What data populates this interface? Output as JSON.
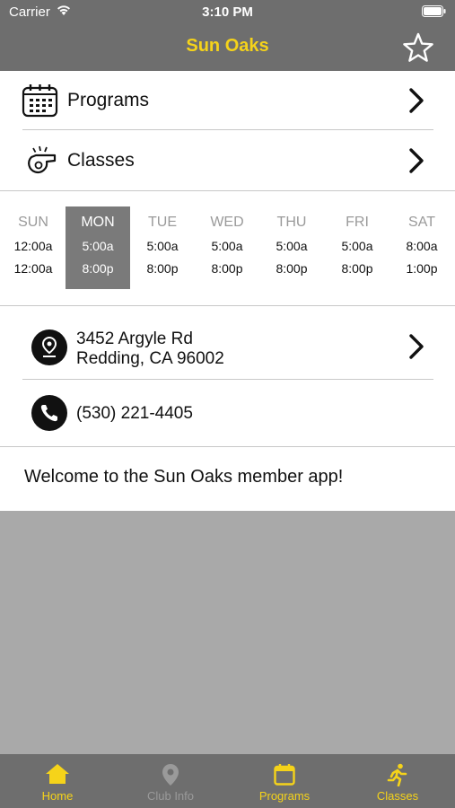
{
  "status_bar": {
    "carrier": "Carrier",
    "time": "3:10 PM"
  },
  "nav": {
    "title": "Sun Oaks",
    "favorite_icon": "star-outline-icon"
  },
  "menu": {
    "programs": {
      "label": "Programs",
      "icon": "calendar-icon"
    },
    "classes": {
      "label": "Classes",
      "icon": "whistle-icon"
    }
  },
  "hours": {
    "days": [
      {
        "name": "SUN",
        "open": "12:00a",
        "close": "12:00a",
        "active": false
      },
      {
        "name": "MON",
        "open": "5:00a",
        "close": "8:00p",
        "active": true
      },
      {
        "name": "TUE",
        "open": "5:00a",
        "close": "8:00p",
        "active": false
      },
      {
        "name": "WED",
        "open": "5:00a",
        "close": "8:00p",
        "active": false
      },
      {
        "name": "THU",
        "open": "5:00a",
        "close": "8:00p",
        "active": false
      },
      {
        "name": "FRI",
        "open": "5:00a",
        "close": "8:00p",
        "active": false
      },
      {
        "name": "SAT",
        "open": "8:00a",
        "close": "1:00p",
        "active": false
      }
    ]
  },
  "contact": {
    "address_line1": "3452 Argyle Rd",
    "address_line2": "Redding, CA 96002",
    "phone": "(530) 221-4405"
  },
  "welcome": "Welcome to the Sun Oaks member app!",
  "tabs": [
    {
      "label": "Home",
      "icon": "home-icon",
      "color": "#f5d31a"
    },
    {
      "label": "Club Info",
      "icon": "map-pin-icon",
      "color": "#9a9a9a"
    },
    {
      "label": "Programs",
      "icon": "calendar-icon",
      "color": "#f5d31a"
    },
    {
      "label": "Classes",
      "icon": "runner-icon",
      "color": "#f5d31a"
    }
  ],
  "colors": {
    "accent": "#f5d31a",
    "header": "#6e6e6e",
    "inactive": "#9a9a9a"
  }
}
